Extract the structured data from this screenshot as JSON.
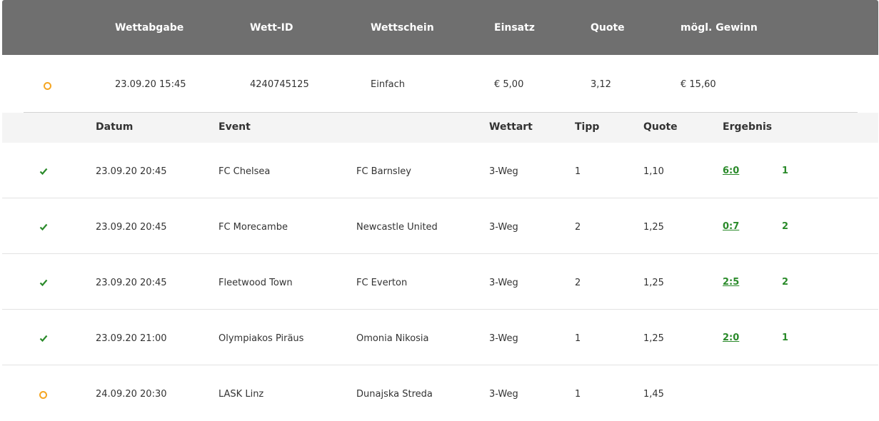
{
  "header": {
    "columns": [
      "Wettabgabe",
      "Wett-ID",
      "Wettschein",
      "Einsatz",
      "Quote",
      "mögl. Gewinn"
    ]
  },
  "bet": {
    "status_icon": "pending-ring-icon",
    "placed": "23.09.20 15:45",
    "id": "4240745125",
    "type": "Einfach",
    "stake": "€ 5,00",
    "odds": "3,12",
    "potential_win": "€ 15,60"
  },
  "selections_header": {
    "columns": [
      "Datum",
      "Event",
      "Wettart",
      "Tipp",
      "Quote",
      "Ergebnis"
    ]
  },
  "selections": [
    {
      "status": "won",
      "date": "23.09.20 20:45",
      "home": "FC Chelsea",
      "away": "FC Barnsley",
      "market": "3-Weg",
      "tip": "1",
      "odds": "1,10",
      "score": "6:0",
      "outcome": "1"
    },
    {
      "status": "won",
      "date": "23.09.20 20:45",
      "home": "FC Morecambe",
      "away": "Newcastle United",
      "market": "3-Weg",
      "tip": "2",
      "odds": "1,25",
      "score": "0:7",
      "outcome": "2"
    },
    {
      "status": "won",
      "date": "23.09.20 20:45",
      "home": "Fleetwood Town",
      "away": "FC Everton",
      "market": "3-Weg",
      "tip": "2",
      "odds": "1,25",
      "score": "2:5",
      "outcome": "2"
    },
    {
      "status": "won",
      "date": "23.09.20 21:00",
      "home": "Olympiakos Piräus",
      "away": "Omonia Nikosia",
      "market": "3-Weg",
      "tip": "1",
      "odds": "1,25",
      "score": "2:0",
      "outcome": "1"
    },
    {
      "status": "pending",
      "date": "24.09.20 20:30",
      "home": "LASK Linz",
      "away": "Dunajska Streda",
      "market": "3-Weg",
      "tip": "1",
      "odds": "1,45",
      "score": "",
      "outcome": ""
    }
  ],
  "colors": {
    "header_bg": "#6f6f6f",
    "subheader_bg": "#f4f4f4",
    "won_green": "#2a8a2a",
    "pending_orange": "#f5a623"
  }
}
